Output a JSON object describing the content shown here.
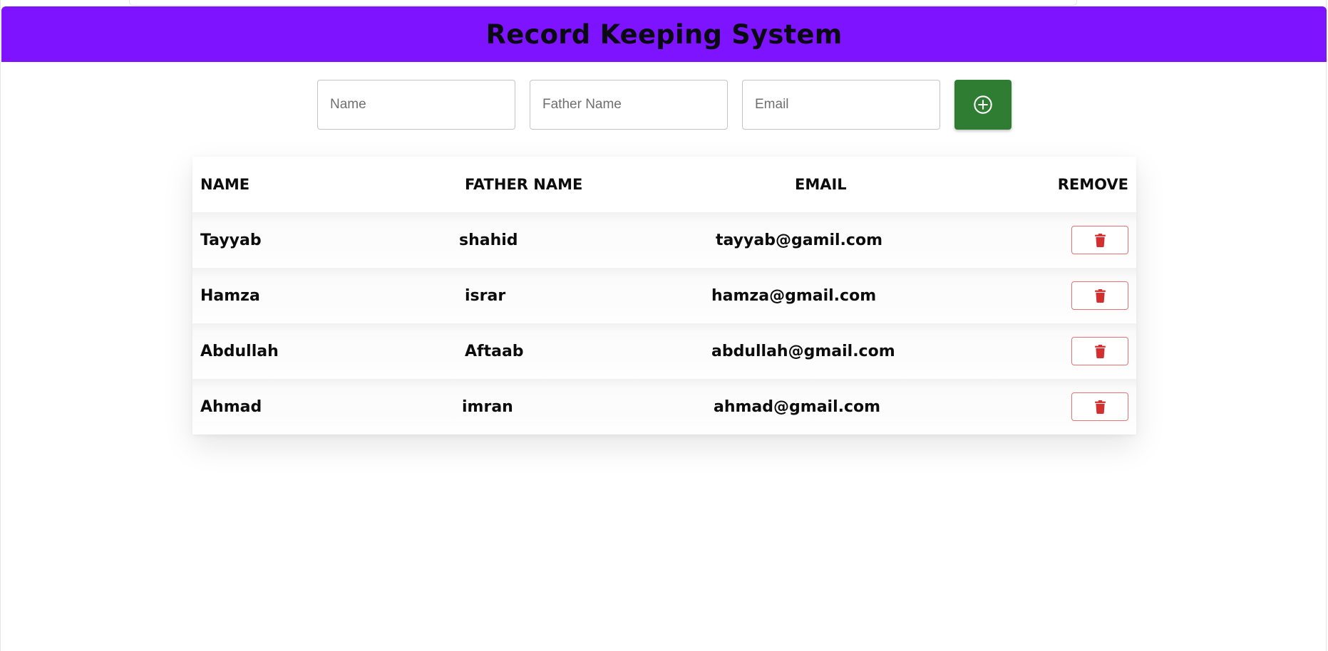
{
  "header": {
    "title": "Record Keeping System"
  },
  "form": {
    "name_placeholder": "Name",
    "father_name_placeholder": "Father Name",
    "email_placeholder": "Email",
    "add_icon": "plus-circle-icon"
  },
  "table": {
    "columns": [
      "NAME",
      "FATHER NAME",
      "EMAIL",
      "REMOVE"
    ],
    "rows": [
      {
        "name": "Tayyab",
        "father": "shahid",
        "email": "tayyab@gamil.com"
      },
      {
        "name": "Hamza",
        "father": "israr",
        "email": "hamza@gmail.com"
      },
      {
        "name": "Abdullah",
        "father": "Aftaab",
        "email": "abdullah@gmail.com"
      },
      {
        "name": "Ahmad",
        "father": "imran",
        "email": "ahmad@gmail.com"
      }
    ],
    "remove_icon": "trash-icon"
  },
  "colors": {
    "header_bg": "#7e14ff",
    "add_button": "#2e7d32",
    "delete_accent": "#d32f2f"
  }
}
